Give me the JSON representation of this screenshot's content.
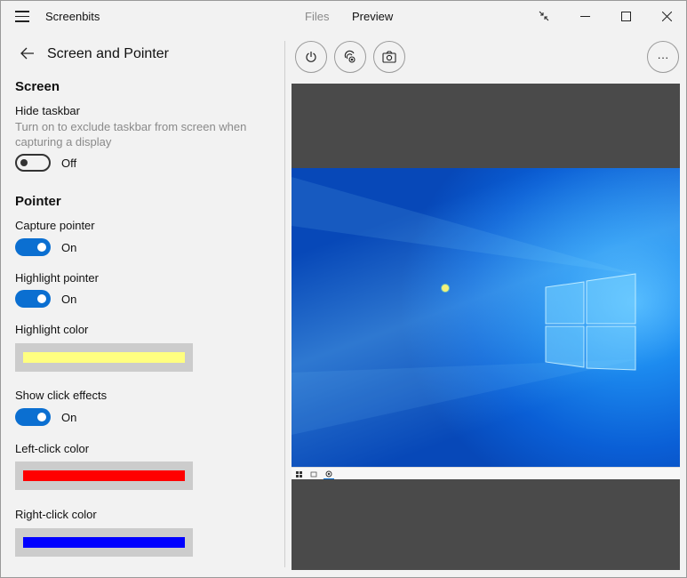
{
  "app": {
    "title": "Screenbits"
  },
  "tabs": [
    {
      "label": "Files",
      "active": false
    },
    {
      "label": "Preview",
      "active": true
    }
  ],
  "window_controls": [
    "compact-overlay-icon",
    "minimize-icon",
    "maximize-icon",
    "close-icon"
  ],
  "settings": {
    "page_title": "Screen and Pointer",
    "screen": {
      "heading": "Screen",
      "hide_taskbar": {
        "label": "Hide taskbar",
        "description": "Turn on to exclude taskbar from screen when capturing a display",
        "state": "Off"
      }
    },
    "pointer": {
      "heading": "Pointer",
      "capture_pointer": {
        "label": "Capture pointer",
        "state": "On"
      },
      "highlight_pointer": {
        "label": "Highlight pointer",
        "state": "On"
      },
      "highlight_color": {
        "label": "Highlight color",
        "color": "#ffff80"
      },
      "show_click_effects": {
        "label": "Show click effects",
        "state": "On"
      },
      "left_click_color": {
        "label": "Left-click color",
        "color": "#ff0000"
      },
      "right_click_color": {
        "label": "Right-click color",
        "color": "#0000ff"
      }
    }
  },
  "toolbar": {
    "buttons": [
      "power-icon",
      "record-pointer-icon",
      "camera-icon"
    ],
    "more": "more-icon",
    "more_label": "···"
  },
  "colors": {
    "accent": "#0b6fd1",
    "preview_background": "#4a4a4a"
  }
}
